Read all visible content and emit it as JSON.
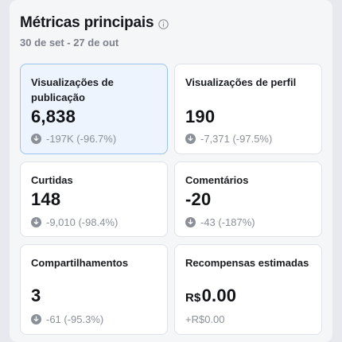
{
  "header": {
    "title": "Métricas principais",
    "info_icon": "info-circle-icon",
    "date_range": "30 de set - 27 de out"
  },
  "colors": {
    "selected_card_bg": "#eef4fd",
    "selected_card_border": "#9cc3f0",
    "muted_text": "#8b8f97"
  },
  "metrics": [
    {
      "label": "Visualizações de publicação",
      "value": "6,838",
      "change": "-197K (-96.7%)",
      "change_icon": "arrow-down-circle-icon",
      "selected": true
    },
    {
      "label": "Visualizações de perfil",
      "value": "190",
      "change": "-7,371 (-97.5%)",
      "change_icon": "arrow-down-circle-icon",
      "selected": false
    },
    {
      "label": "Curtidas",
      "value": "148",
      "change": "-9,010 (-98.4%)",
      "change_icon": "arrow-down-circle-icon",
      "selected": false
    },
    {
      "label": "Comentários",
      "value": "-20",
      "change": "-43 (-187%)",
      "change_icon": "arrow-down-circle-icon",
      "selected": false
    },
    {
      "label": "Compartilhamentos",
      "value": "3",
      "change": "-61 (-95.3%)",
      "change_icon": "arrow-down-circle-icon",
      "selected": false
    },
    {
      "label": "Recompensas estimadas",
      "currency": "R$",
      "value": "0.00",
      "change": "+R$0.00",
      "selected": false
    }
  ]
}
